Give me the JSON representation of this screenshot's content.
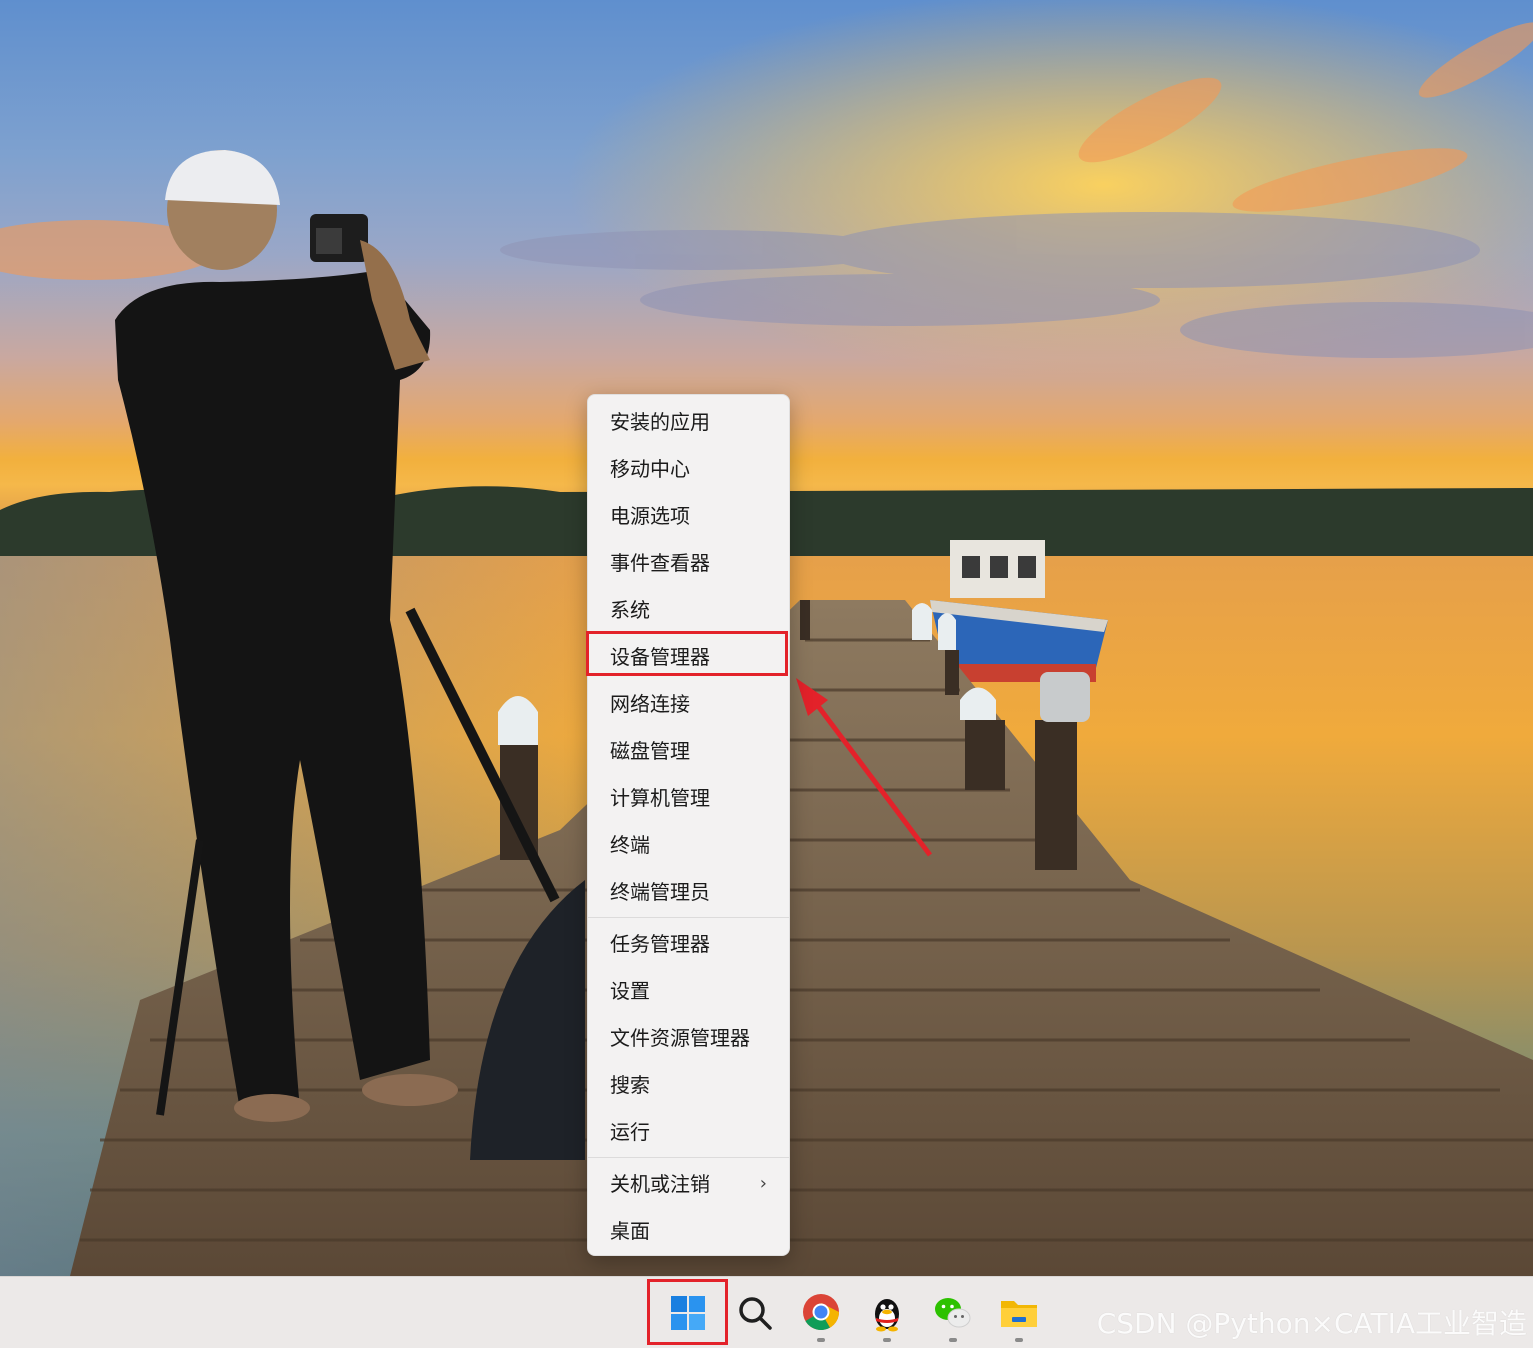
{
  "menu": {
    "items": [
      {
        "label": "安装的应用"
      },
      {
        "label": "移动中心"
      },
      {
        "label": "电源选项"
      },
      {
        "label": "事件查看器"
      },
      {
        "label": "系统"
      },
      {
        "label": "设备管理器",
        "highlighted": true
      },
      {
        "label": "网络连接"
      },
      {
        "label": "磁盘管理"
      },
      {
        "label": "计算机管理"
      },
      {
        "label": "终端"
      },
      {
        "label": "终端管理员"
      },
      {
        "label": "任务管理器"
      },
      {
        "label": "设置"
      },
      {
        "label": "文件资源管理器"
      },
      {
        "label": "搜索"
      },
      {
        "label": "运行"
      },
      {
        "label": "关机或注销",
        "submenu_chevron": "›"
      },
      {
        "label": "桌面"
      }
    ]
  },
  "taskbar": {
    "apps": [
      {
        "name": "start",
        "icon": "windows-logo-icon"
      },
      {
        "name": "search",
        "icon": "search-icon"
      },
      {
        "name": "chrome",
        "icon": "chrome-icon",
        "running": true
      },
      {
        "name": "qq",
        "icon": "qq-penguin-icon",
        "running": true
      },
      {
        "name": "wechat",
        "icon": "wechat-icon",
        "running": true
      },
      {
        "name": "file-explorer",
        "icon": "folder-icon",
        "running": true
      }
    ]
  },
  "watermark": "CSDN @Python×CATIA工业智造",
  "annotation_color": "#e3222a"
}
